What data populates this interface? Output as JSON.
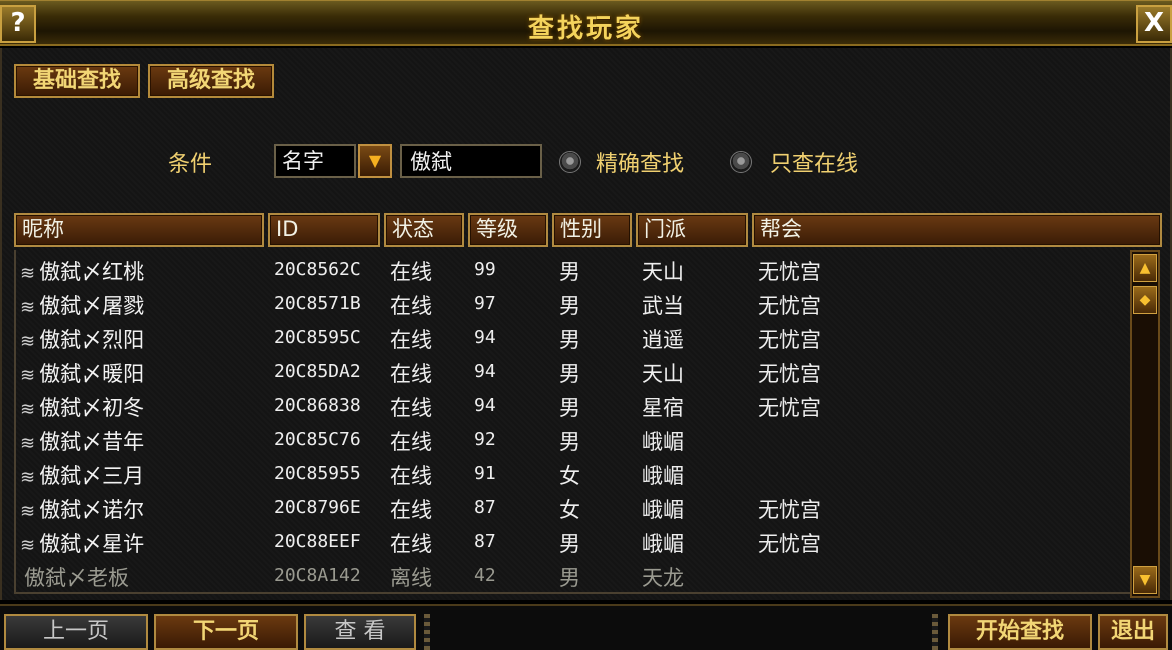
{
  "window": {
    "title": "查找玩家",
    "help_glyph": "?",
    "close_glyph": "X"
  },
  "tabs": {
    "basic": "基础查找",
    "advanced": "高级查找"
  },
  "search": {
    "condition_label": "条件",
    "field_selected": "名字",
    "query_value": "傲弑",
    "exact_label": "精确查找",
    "online_only_label": "只查在线"
  },
  "columns": {
    "nickname": "昵称",
    "id": "ID",
    "status": "状态",
    "level": "等级",
    "gender": "性别",
    "sect": "门派",
    "guild": "帮会"
  },
  "rows": [
    {
      "mark": "≋",
      "name": "傲弑〆红桃",
      "id": "20C8562C",
      "status": "在线",
      "level": "99",
      "gender": "男",
      "sect": "天山",
      "guild": "无忧宫"
    },
    {
      "mark": "≋",
      "name": "傲弑〆屠戮",
      "id": "20C8571B",
      "status": "在线",
      "level": "97",
      "gender": "男",
      "sect": "武当",
      "guild": "无忧宫"
    },
    {
      "mark": "≋",
      "name": "傲弑〆烈阳",
      "id": "20C8595C",
      "status": "在线",
      "level": "94",
      "gender": "男",
      "sect": "逍遥",
      "guild": "无忧宫"
    },
    {
      "mark": "≋",
      "name": "傲弑〆暖阳",
      "id": "20C85DA2",
      "status": "在线",
      "level": "94",
      "gender": "男",
      "sect": "天山",
      "guild": "无忧宫"
    },
    {
      "mark": "≋",
      "name": "傲弑〆初冬",
      "id": "20C86838",
      "status": "在线",
      "level": "94",
      "gender": "男",
      "sect": "星宿",
      "guild": "无忧宫"
    },
    {
      "mark": "≋",
      "name": "傲弑〆昔年",
      "id": "20C85C76",
      "status": "在线",
      "level": "92",
      "gender": "男",
      "sect": "峨嵋",
      "guild": ""
    },
    {
      "mark": "≋",
      "name": "傲弑〆三月",
      "id": "20C85955",
      "status": "在线",
      "level": "91",
      "gender": "女",
      "sect": "峨嵋",
      "guild": ""
    },
    {
      "mark": "≋",
      "name": "傲弑〆诺尔",
      "id": "20C8796E",
      "status": "在线",
      "level": "87",
      "gender": "女",
      "sect": "峨嵋",
      "guild": "无忧宫"
    },
    {
      "mark": "≋",
      "name": "傲弑〆星许",
      "id": "20C88EEF",
      "status": "在线",
      "level": "87",
      "gender": "男",
      "sect": "峨嵋",
      "guild": "无忧宫"
    },
    {
      "mark": "",
      "name": "傲弑〆老板",
      "id": "20C8A142",
      "status": "离线",
      "level": "42",
      "gender": "男",
      "sect": "天龙",
      "guild": ""
    }
  ],
  "footer": {
    "prev_page": "上一页",
    "next_page": "下一页",
    "view": "查 看",
    "start_search": "开始查找",
    "exit": "退出"
  },
  "colors": {
    "title_gold": "#f4d35c",
    "label_gold": "#f0d070",
    "button_brown": "#6b3a10",
    "border_gold": "#b08a40",
    "offline_gray": "#9a9a90"
  },
  "icons": {
    "dropdown": "chevron-down-icon",
    "scroll_up": "arrow-up-icon",
    "scroll_down": "arrow-down-icon"
  }
}
